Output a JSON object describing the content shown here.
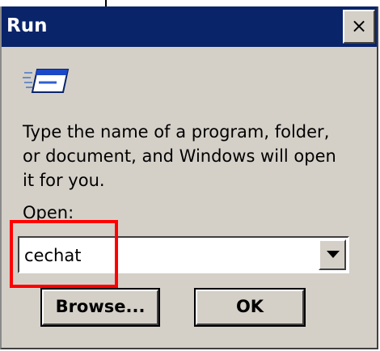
{
  "window": {
    "title": "Run",
    "close_label": "×"
  },
  "dialog": {
    "description": "Type the name of a program, folder,\nor document, and Windows will open\nit for you.",
    "open_label": "Open:",
    "open_value": "cechat",
    "browse_label": "Browse...",
    "ok_label": "OK"
  },
  "icons": {
    "run": "run-program-icon",
    "dropdown": "chevron-down-icon",
    "close": "close-icon"
  },
  "colors": {
    "titlebar": "#0a246a",
    "face": "#d4d0c8",
    "highlight": "#ff0000"
  }
}
